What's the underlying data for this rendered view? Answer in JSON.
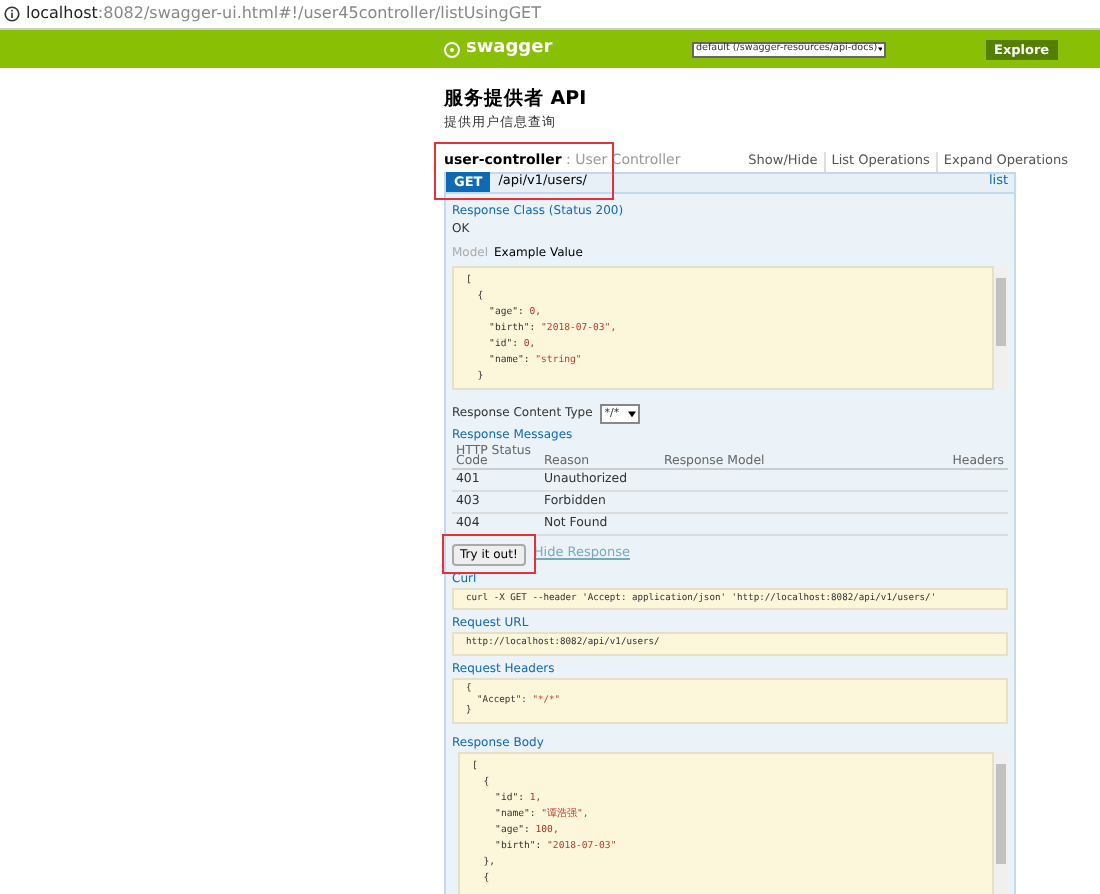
{
  "address_bar": {
    "url_host": "localhost",
    "url_rest": ":8082/swagger-ui.html#!/user45controller/listUsingGET"
  },
  "header": {
    "logo": "swagger",
    "spec_select": "default (/swagger-resources/api-docs)",
    "explore": "Explore"
  },
  "api": {
    "title": "服务提供者 API",
    "description": "提供用户信息查询"
  },
  "controller": {
    "name": "user-controller",
    "description": ": User Controller",
    "highlighted": true,
    "links": [
      "Show/Hide",
      "List Operations",
      "Expand Operations"
    ]
  },
  "operation": {
    "method": "GET",
    "path": "/api/v1/users/",
    "summary": "list",
    "response_class": {
      "heading": "Response Class (Status 200)",
      "status": "OK",
      "tabs": [
        {
          "label": "Model",
          "selected": false
        },
        {
          "label": "Example Value",
          "selected": true
        }
      ],
      "example": [
        "[",
        "  {",
        "    \"age\": 0,",
        "    \"birth\": \"2018-07-03\",",
        "    \"id\": 0,",
        "    \"name\": \"string\"",
        "  }"
      ]
    },
    "content_type": {
      "label": "Response Content Type",
      "value": "*/*"
    },
    "messages": {
      "heading": "Response Messages",
      "columns": [
        "HTTP Status Code",
        "Reason",
        "Response Model",
        "Headers"
      ],
      "rows": [
        {
          "code": "401",
          "reason": "Unauthorized"
        },
        {
          "code": "403",
          "reason": "Forbidden"
        },
        {
          "code": "404",
          "reason": "Not Found"
        }
      ]
    },
    "try_button": {
      "label": "Try it out!",
      "highlighted": true
    },
    "hide_link": "Hide Response",
    "results": [
      {
        "heading": "Curl",
        "lines": [
          "curl -X GET --header 'Accept: application/json' 'http://localhost:8082/api/v1/users/'"
        ]
      },
      {
        "heading": "Request URL",
        "lines": [
          "http://localhost:8082/api/v1/users/"
        ]
      },
      {
        "heading": "Request Headers",
        "lines": [
          "{",
          "  \"Accept\": \"*/*\"",
          "}"
        ]
      }
    ],
    "response_body": {
      "heading": "Response Body",
      "lines": [
        "[",
        "  {",
        "    \"id\": 1,",
        "    \"name\": \"谭浩强\",",
        "    \"age\": 100,",
        "    \"birth\": \"2018-07-03\"",
        "  },",
        "  {"
      ]
    }
  }
}
